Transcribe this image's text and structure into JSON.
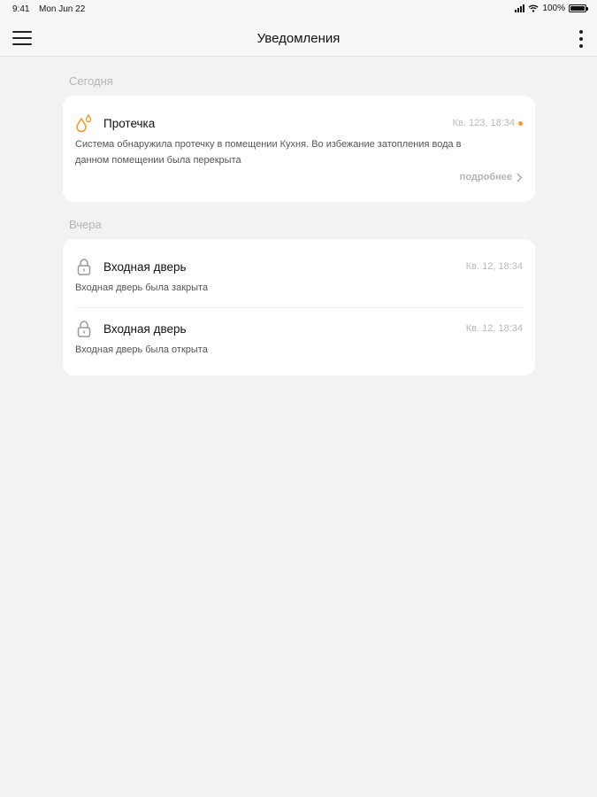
{
  "status_bar": {
    "time": "9:41",
    "date": "Mon Jun 22",
    "battery": "100%"
  },
  "header": {
    "title": "Уведомления",
    "menu_icon": "hamburger-icon",
    "more_icon": "more-vertical-icon"
  },
  "sections": [
    {
      "title": "Сегодня",
      "items": [
        {
          "icon": "water-drops-icon",
          "title": "Протечка",
          "time": "Кв. 123, 18:34",
          "unread": true,
          "text_line1": "Система обнаружила протечку в помещении Кухня. Во избежание затопления вода в",
          "text_line2": "данном помещении была перекрыта",
          "more_label": "подробнее"
        }
      ]
    },
    {
      "title": "Вчера",
      "items": [
        {
          "icon": "lock-icon",
          "title": "Входная дверь",
          "time": "Кв. 12, 18:34",
          "text": "Входная дверь была закрыта"
        },
        {
          "icon": "lock-icon",
          "title": "Входная дверь",
          "time": "Кв. 12, 18:34",
          "text": "Входная дверь была открыта"
        }
      ]
    }
  ],
  "colors": {
    "accent": "#f59a23",
    "background": "#f2f2f2",
    "card": "#ffffff",
    "muted": "#b4b4b4"
  }
}
